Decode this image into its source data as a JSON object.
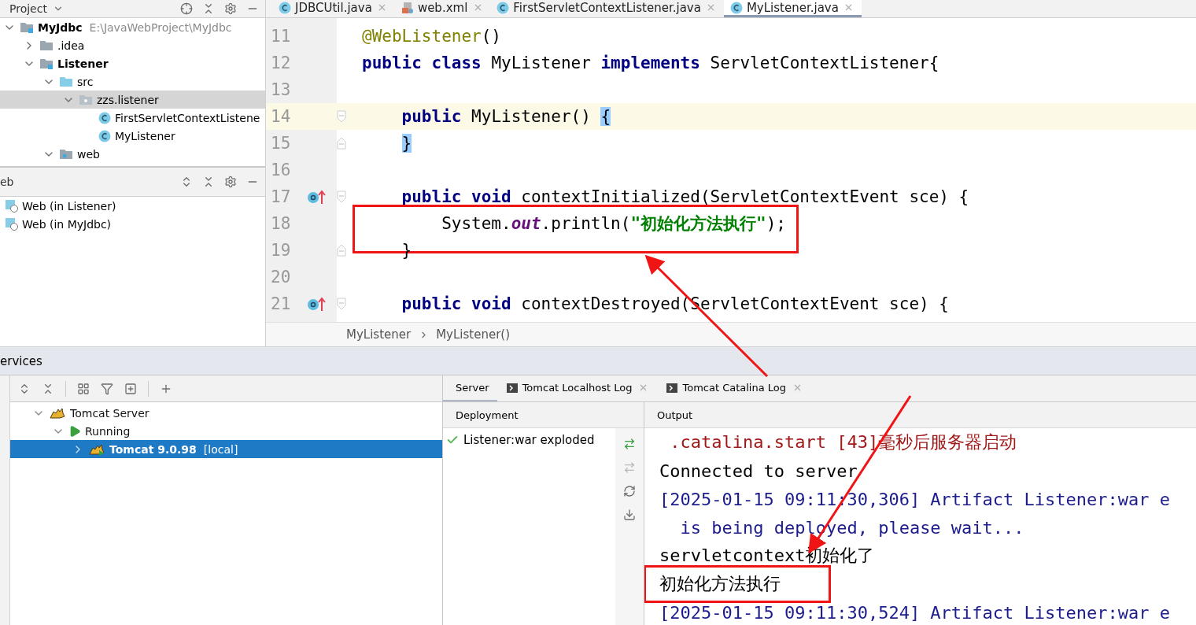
{
  "project_panel": {
    "title": "Project",
    "tree": [
      {
        "name": "MyJdbc",
        "path": "E:\\JavaWebProject\\MyJdbc",
        "kind": "module",
        "expanded": true,
        "selected": false,
        "children": [
          {
            "name": ".idea",
            "kind": "folder",
            "expanded": false,
            "selected": false
          },
          {
            "name": "Listener",
            "kind": "module",
            "expanded": true,
            "selected": false,
            "children": [
              {
                "name": "src",
                "kind": "source",
                "expanded": true,
                "selected": false,
                "children": [
                  {
                    "name": "zzs.listener",
                    "kind": "package",
                    "expanded": true,
                    "selected": true,
                    "children": [
                      {
                        "name": "FirstServletContextListene",
                        "kind": "class",
                        "selected": false
                      },
                      {
                        "name": "MyListener",
                        "kind": "class",
                        "selected": false
                      }
                    ]
                  }
                ]
              },
              {
                "name": "web",
                "kind": "web",
                "expanded": true,
                "selected": false
              }
            ]
          }
        ]
      }
    ]
  },
  "web_panel": {
    "title": "eb",
    "items": [
      {
        "label": "Web (in Listener)"
      },
      {
        "label": "Web (in MyJdbc)"
      }
    ]
  },
  "editor": {
    "tabs": [
      {
        "label": "JDBCUtil.java",
        "kind": "class",
        "selected": false
      },
      {
        "label": "web.xml",
        "kind": "xml",
        "selected": false
      },
      {
        "label": "FirstServletContextListener.java",
        "kind": "class",
        "selected": false
      },
      {
        "label": "MyListener.java",
        "kind": "class",
        "selected": true
      }
    ],
    "lines": [
      {
        "number": "11",
        "highlighted": false,
        "fold_open": false,
        "fold_close": false,
        "override": false,
        "tokens": [
          {
            "text": "@WebListener",
            "kind": "annotation"
          },
          {
            "text": "()",
            "kind": "plain"
          }
        ]
      },
      {
        "number": "12",
        "highlighted": false,
        "fold_open": false,
        "fold_close": false,
        "override": false,
        "tokens": [
          {
            "text": "public class",
            "kind": "keyword"
          },
          {
            "text": " MyListener ",
            "kind": "plain"
          },
          {
            "text": "implements",
            "kind": "keyword"
          },
          {
            "text": " ServletContextListener{",
            "kind": "plain"
          }
        ]
      },
      {
        "number": "13",
        "highlighted": false,
        "fold_open": false,
        "fold_close": false,
        "override": false
      },
      {
        "number": "14",
        "highlighted": true,
        "fold_open": true,
        "fold_close": false,
        "override": false,
        "tokens": [
          {
            "text": "    public",
            "kind": "keyword"
          },
          {
            "text": " MyListener() ",
            "kind": "plain"
          },
          {
            "text": "{",
            "kind": "brace"
          }
        ]
      },
      {
        "number": "15",
        "highlighted": false,
        "fold_open": false,
        "fold_close": true,
        "override": false,
        "tokens": [
          {
            "text": "    }",
            "kind": "brace"
          }
        ]
      },
      {
        "number": "16",
        "highlighted": false,
        "fold_open": false,
        "fold_close": false,
        "override": false
      },
      {
        "number": "17",
        "highlighted": false,
        "fold_open": true,
        "fold_close": false,
        "override": true,
        "tokens": [
          {
            "text": "    public void",
            "kind": "keyword"
          },
          {
            "text": " contextInitialized(ServletContextEvent sce) {",
            "kind": "plain"
          }
        ]
      },
      {
        "number": "18",
        "highlighted": false,
        "fold_open": false,
        "fold_close": false,
        "override": false,
        "framed": true,
        "tokens": [
          {
            "text": "        System.",
            "kind": "plain"
          },
          {
            "text": "out",
            "kind": "field"
          },
          {
            "text": ".println(",
            "kind": "plain"
          },
          {
            "text": "\"初始化方法执行\"",
            "kind": "string"
          },
          {
            "text": ");",
            "kind": "plain"
          }
        ]
      },
      {
        "number": "19",
        "highlighted": false,
        "fold_open": false,
        "fold_close": true,
        "override": false,
        "tokens": [
          {
            "text": "    }",
            "kind": "plain"
          }
        ]
      },
      {
        "number": "20",
        "highlighted": false,
        "fold_open": false,
        "fold_close": false,
        "override": false
      },
      {
        "number": "21",
        "highlighted": false,
        "fold_open": true,
        "fold_close": false,
        "override": true,
        "tokens": [
          {
            "text": "    public void",
            "kind": "keyword"
          },
          {
            "text": " contextDestroyed(ServletContextEvent sce) {",
            "kind": "plain"
          }
        ]
      }
    ],
    "breadcrumbs": [
      "MyListener",
      "MyListener()"
    ]
  },
  "services": {
    "title": "ervices",
    "tree": [
      {
        "label": "Tomcat Server",
        "kind": "server",
        "expanded": true,
        "selected": false,
        "children": [
          {
            "label": "Running",
            "kind": "running",
            "expanded": true,
            "selected": false,
            "children": [
              {
                "label": "Tomcat 9.0.98",
                "suffix": "[local]",
                "kind": "instance",
                "expanded": false,
                "selected": true
              }
            ]
          }
        ]
      }
    ],
    "tabs": [
      {
        "label": "Server",
        "closable": false,
        "selected": true
      },
      {
        "label": "Tomcat Localhost Log",
        "closable": true,
        "selected": false
      },
      {
        "label": "Tomcat Catalina Log",
        "closable": true,
        "selected": false
      }
    ],
    "deployment": {
      "header": "Deployment",
      "items": [
        {
          "label": "Listener:war exploded",
          "deployed": true
        }
      ]
    },
    "output": {
      "header": "Output",
      "lines": [
        {
          "text": " .catalina.start [43]毫秒后服务器启动",
          "kind": "error"
        },
        {
          "text": "Connected to server",
          "kind": "plain"
        },
        {
          "text": "[2025-01-15 09:11:30,306] Artifact Listener:war e",
          "kind": "info"
        },
        {
          "text": "  is being deployed, please wait...",
          "kind": "info"
        },
        {
          "text": "servletcontext初始化了",
          "kind": "plain"
        },
        {
          "text": "初始化方法执行",
          "kind": "plain",
          "framed": true
        },
        {
          "text": "[2025-01-15 09:11:30,524] Artifact Listener:war e",
          "kind": "info"
        }
      ]
    }
  }
}
